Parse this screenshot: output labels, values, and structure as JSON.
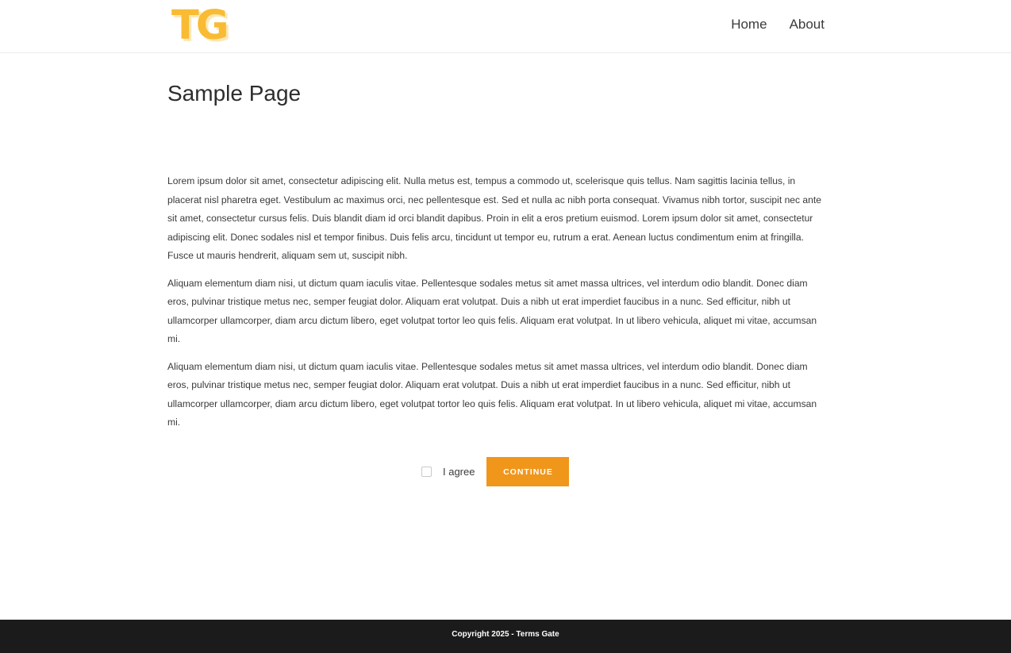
{
  "header": {
    "logo_text": "TG",
    "nav": [
      {
        "label": "Home"
      },
      {
        "label": "About"
      }
    ]
  },
  "main": {
    "title": "Sample Page",
    "paragraphs": [
      "Lorem ipsum dolor sit amet, consectetur adipiscing elit. Nulla metus est, tempus a commodo ut, scelerisque quis tellus. Nam sagittis lacinia tellus, in placerat nisl pharetra eget. Vestibulum ac maximus orci, nec pellentesque est. Sed et nulla ac nibh porta consequat. Vivamus nibh tortor, suscipit nec ante sit amet, consectetur cursus felis. Duis blandit diam id orci blandit dapibus. Proin in elit a eros pretium euismod. Lorem ipsum dolor sit amet, consectetur adipiscing elit. Donec sodales nisl et tempor finibus. Duis felis arcu, tincidunt ut tempor eu, rutrum a erat. Aenean luctus condimentum enim at fringilla. Fusce ut mauris hendrerit, aliquam sem ut, suscipit nibh.",
      "Aliquam elementum diam nisi, ut dictum quam iaculis vitae. Pellentesque sodales metus sit amet massa ultrices, vel interdum odio blandit. Donec diam eros, pulvinar tristique metus nec, semper feugiat dolor. Aliquam erat volutpat. Duis a nibh ut erat imperdiet faucibus in a nunc. Sed efficitur, nibh ut ullamcorper ullamcorper, diam arcu dictum libero, eget volutpat tortor leo quis felis. Aliquam erat volutpat. In ut libero vehicula, aliquet mi vitae, accumsan mi.",
      "Aliquam elementum diam nisi, ut dictum quam iaculis vitae. Pellentesque sodales metus sit amet massa ultrices, vel interdum odio blandit. Donec diam eros, pulvinar tristique metus nec, semper feugiat dolor. Aliquam erat volutpat. Duis a nibh ut erat imperdiet faucibus in a nunc. Sed efficitur, nibh ut ullamcorper ullamcorper, diam arcu dictum libero, eget volutpat tortor leo quis felis. Aliquam erat volutpat. In ut libero vehicula, aliquet mi vitae, accumsan mi."
    ],
    "agree_label": "I agree",
    "agree_checked": false,
    "continue_label": "CONTINUE"
  },
  "footer": {
    "copyright": "Copyright 2025 - Terms Gate"
  },
  "colors": {
    "logo": "#f8bb33",
    "logo_shadow": "#fde7b4",
    "button": "#f0961b",
    "footer_bg": "#1b1b1b"
  }
}
